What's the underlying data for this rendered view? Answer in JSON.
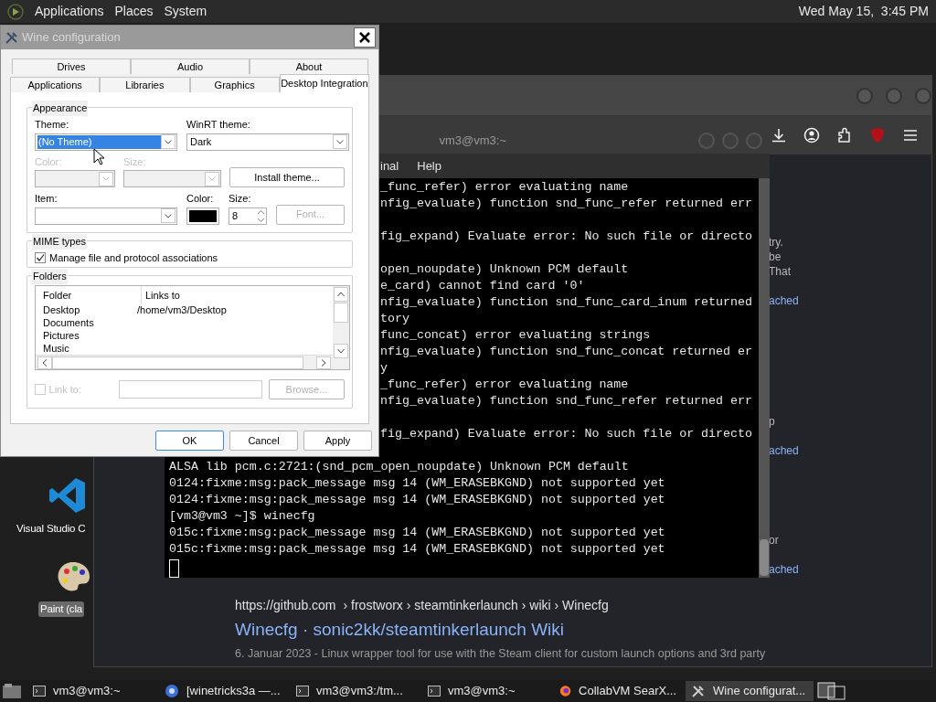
{
  "top_panel": {
    "menus": [
      "Applications",
      "Places",
      "System"
    ],
    "clock": "Wed May 15,  3:45 PM"
  },
  "desktop_icons": [
    {
      "label": "Visual Studio C",
      "selected": false,
      "kind": "code"
    },
    {
      "label": "Paint (cla",
      "selected": true,
      "kind": "paint"
    }
  ],
  "browser": {
    "fragments": [
      {
        "lines": [
          "try.",
          "be",
          "That"
        ],
        "link": "ached"
      },
      {
        "lines": [
          "p"
        ],
        "link": "ached"
      },
      {
        "lines": [
          "or"
        ],
        "link": "ached"
      }
    ],
    "result": {
      "url": "https://github.com",
      "crumbs": "› frostworx › steamtinkerlaunch › wiki › Winecfg",
      "title": "Winecfg · sonic2kk/steamtinkerlaunch Wiki",
      "snippet": "6. Januar 2023 - Linux wrapper tool for use with the Steam client for custom launch options and 3rd party"
    }
  },
  "terminal": {
    "title": "vm3@vm3:~",
    "menus": [
      "inal",
      "Help"
    ],
    "lines": [
      {
        "kind": "partial",
        "text": "_func_refer) error evaluating name"
      },
      {
        "kind": "partial",
        "text": "nfig_evaluate) function snd_func_refer returned err"
      },
      {
        "kind": "blank"
      },
      {
        "kind": "partial",
        "text": "fig_expand) Evaluate error: No such file or directo"
      },
      {
        "kind": "blank"
      },
      {
        "kind": "partial",
        "text": "open_noupdate) Unknown PCM default"
      },
      {
        "kind": "partial",
        "text": "e_card) cannot find card '0'"
      },
      {
        "kind": "partial",
        "text": "nfig_evaluate) function snd_func_card_inum returned"
      },
      {
        "kind": "partial",
        "text": "tory"
      },
      {
        "kind": "partial",
        "text": "func_concat) error evaluating strings"
      },
      {
        "kind": "partial",
        "text": "nfig_evaluate) function snd_func_concat returned er"
      },
      {
        "kind": "partial",
        "text": "y"
      },
      {
        "kind": "partial",
        "text": "_func_refer) error evaluating name"
      },
      {
        "kind": "partial",
        "text": "nfig_evaluate) function snd_func_refer returned err"
      },
      {
        "kind": "blank"
      },
      {
        "kind": "partial",
        "text": "fig_expand) Evaluate error: No such file or directo"
      },
      {
        "kind": "blank"
      },
      {
        "kind": "full",
        "text": "ALSA lib pcm.c:2721:(snd_pcm_open_noupdate) Unknown PCM default"
      },
      {
        "kind": "full",
        "text": "0124:fixme:msg:pack_message msg 14 (WM_ERASEBKGND) not supported yet"
      },
      {
        "kind": "full",
        "text": "0124:fixme:msg:pack_message msg 14 (WM_ERASEBKGND) not supported yet"
      },
      {
        "kind": "full",
        "text": "[vm3@vm3 ~]$ winecfg"
      },
      {
        "kind": "full",
        "text": "015c:fixme:msg:pack_message msg 14 (WM_ERASEBKGND) not supported yet"
      },
      {
        "kind": "full",
        "text": "015c:fixme:msg:pack_message msg 14 (WM_ERASEBKGND) not supported yet"
      },
      {
        "kind": "cursor"
      }
    ]
  },
  "wine_dialog": {
    "title": "Wine configuration",
    "tab_rows": [
      [
        {
          "label": "Drives",
          "selected": false
        },
        {
          "label": "Audio",
          "selected": false
        },
        {
          "label": "About",
          "selected": false
        }
      ],
      [
        {
          "label": "Applications",
          "selected": false
        },
        {
          "label": "Libraries",
          "selected": false
        },
        {
          "label": "Graphics",
          "selected": false
        },
        {
          "label": "Desktop Integration",
          "selected": true
        }
      ]
    ],
    "appearance": {
      "legend": "Appearance",
      "theme": {
        "label": "Theme:",
        "value": "(No Theme)",
        "focused": true
      },
      "winrt": {
        "label": "WinRT theme:",
        "value": "Dark"
      },
      "color": {
        "label": "Color:",
        "disabled": true
      },
      "size": {
        "label": "Size:",
        "disabled": true
      },
      "install_button": "Install theme...",
      "item": {
        "label": "Item:"
      },
      "item_color": {
        "label": "Color:",
        "color": "#000000"
      },
      "item_size": {
        "label": "Size:",
        "value": "8"
      },
      "font_button": {
        "label": "Font...",
        "disabled": true
      }
    },
    "mime": {
      "legend": "MIME types",
      "checkbox": {
        "label": "Manage file and protocol associations",
        "checked": true
      }
    },
    "folders": {
      "legend": "Folders",
      "columns": [
        "Folder",
        "Links to"
      ],
      "rows": [
        {
          "folder": "Desktop",
          "link": "/home/vm3/Desktop"
        },
        {
          "folder": "Documents"
        },
        {
          "folder": "Pictures"
        },
        {
          "folder": "Music"
        }
      ],
      "link_to": {
        "label": "Link to:",
        "checked": false,
        "disabled": true
      },
      "browse": {
        "label": "Browse...",
        "disabled": true
      }
    },
    "buttons": [
      {
        "label": "OK",
        "kind": "default"
      },
      {
        "label": "Cancel",
        "kind": "normal"
      },
      {
        "label": "Apply",
        "kind": "normal"
      }
    ]
  },
  "taskbar": {
    "items": [
      {
        "label": "vm3@vm3:~",
        "kind": "terminal",
        "selected": false
      },
      {
        "label": "[winetricks3a —...",
        "kind": "chrome",
        "selected": false
      },
      {
        "label": "vm3@vm3:/tm...",
        "kind": "terminal",
        "selected": false
      },
      {
        "label": "vm3@vm3:~",
        "kind": "terminal",
        "selected": false
      },
      {
        "label": "CollabVM SearX...",
        "kind": "firefox",
        "selected": false
      },
      {
        "label": "Wine configurat...",
        "kind": "wine",
        "selected": true
      }
    ]
  }
}
